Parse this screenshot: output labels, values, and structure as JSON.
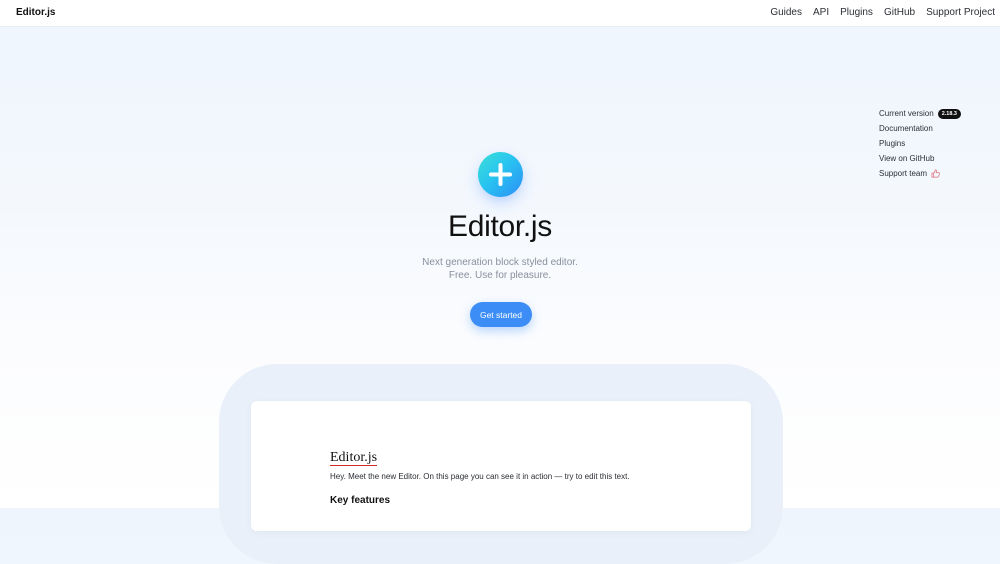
{
  "header": {
    "brand": "Editor.js",
    "nav": [
      "Guides",
      "API",
      "Plugins",
      "GitHub",
      "Support Project"
    ]
  },
  "sidebar": {
    "current_version_label": "Current version",
    "version": "2.18.3",
    "links": [
      "Documentation",
      "Plugins",
      "View on GitHub"
    ],
    "support_label": "Support team",
    "support_icon": "thumbs-up-icon"
  },
  "hero": {
    "logo_icon": "plus-icon",
    "title": "Editor.js",
    "subtitle_line1": "Next generation block styled editor.",
    "subtitle_line2": "Free. Use for pleasure.",
    "cta_label": "Get started"
  },
  "demo": {
    "title": "Editor.js",
    "paragraph": "Hey. Meet the new Editor. On this page you can see it in action — try to edit this text.",
    "heading": "Key features"
  },
  "colors": {
    "accent": "#3c8ef6",
    "logo_gradient_start": "#3ce0d6",
    "logo_gradient_end": "#2d8ef5",
    "spellcheck_underline": "#d12a2a"
  }
}
